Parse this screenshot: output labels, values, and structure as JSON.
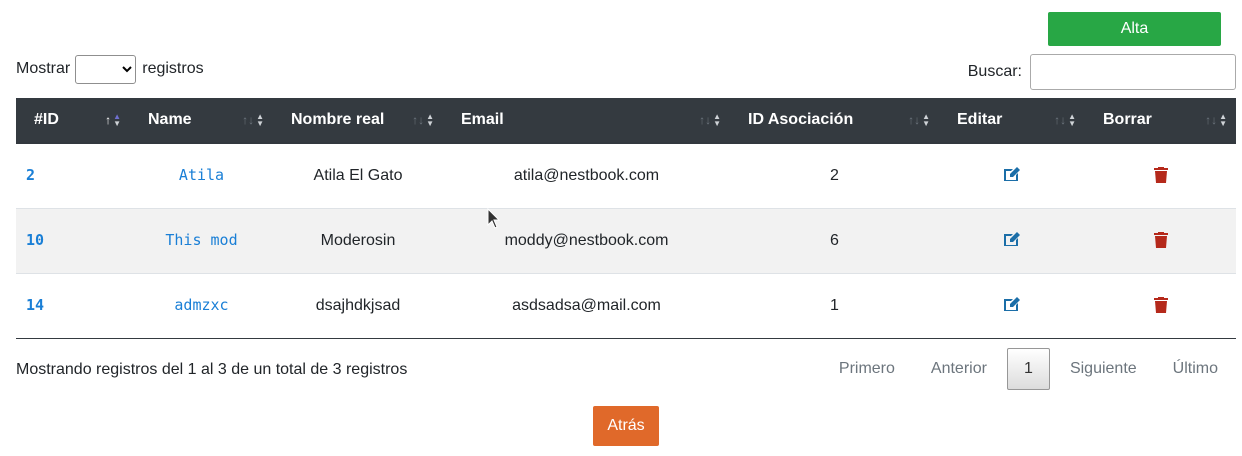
{
  "toolbar": {
    "add_label": "Alta"
  },
  "length": {
    "prefix": "Mostrar",
    "suffix": "registros",
    "selected": ""
  },
  "search": {
    "label": "Buscar:",
    "value": ""
  },
  "table": {
    "columns": [
      "#ID",
      "Name",
      "Nombre real",
      "Email",
      "ID Asociación",
      "Editar",
      "Borrar"
    ],
    "rows": [
      {
        "id": "2",
        "name": "Atila",
        "real_name": "Atila El Gato",
        "email": "atila@nestbook.com",
        "assoc_id": "2"
      },
      {
        "id": "10",
        "name": "This mod",
        "real_name": "Moderosin",
        "email": "moddy@nestbook.com",
        "assoc_id": "6"
      },
      {
        "id": "14",
        "name": "admzxc",
        "real_name": "dsajhdkjsad",
        "email": "asdsadsa@mail.com",
        "assoc_id": "1"
      }
    ]
  },
  "info": "Mostrando registros del 1 al 3 de un total de 3 registros",
  "pagination": {
    "first": "Primero",
    "prev": "Anterior",
    "current": "1",
    "next": "Siguiente",
    "last": "Último"
  },
  "back_label": "Atrás",
  "colors": {
    "add": "#28a745",
    "back": "#e0692a",
    "header": "#343a40",
    "link": "#1a7fd6",
    "edit_icon": "#1b6ea8",
    "delete_icon": "#b5291b"
  },
  "icons": {
    "edit": "edit-icon",
    "delete": "trash-icon"
  }
}
